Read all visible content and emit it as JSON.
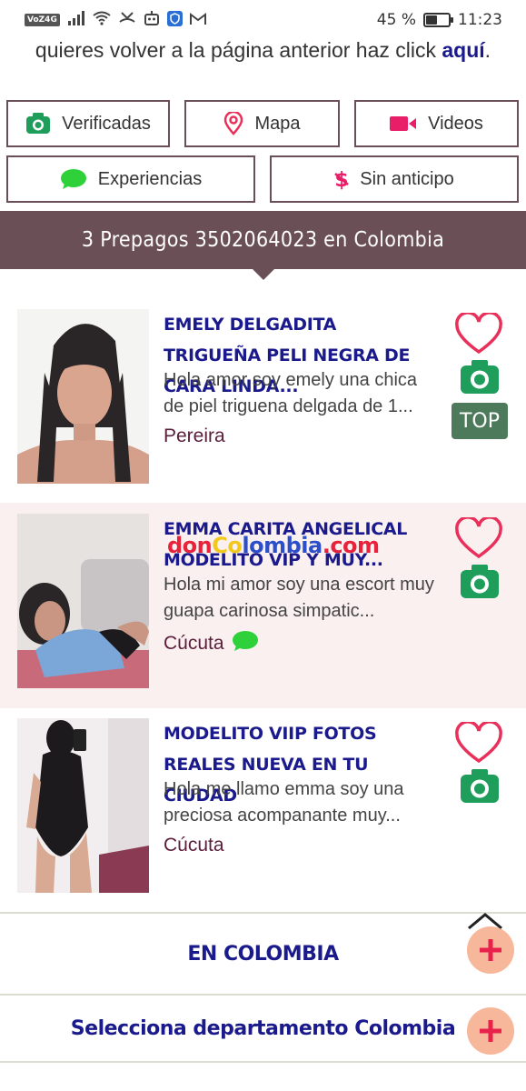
{
  "status_bar": {
    "carrier_badge": "VoZ4G",
    "battery_text": "45 %",
    "battery_level": 0.45,
    "time": "11:23",
    "icons": [
      "signal-icon",
      "wifi-icon",
      "missed-call-icon",
      "bot-icon",
      "shield-icon",
      "gmail-icon"
    ]
  },
  "back_line": {
    "text": "quieres volver a la página anterior haz click ",
    "link": "aquí",
    "suffix": "."
  },
  "filters": {
    "verificadas": "Verificadas",
    "mapa": "Mapa",
    "videos": "Videos",
    "experiencias": "Experiencias",
    "sin_anticipo": "Sin anticipo"
  },
  "banner_title": "3 Prepagos 3502064023 en Colombia",
  "listings": [
    {
      "title": "EMELY DELGADITA TRIGUEÑA PELI NEGRA DE CARA LINDA...",
      "description": "Hola amor soy emely una chica de piel triguena delgada de 1...",
      "city": "Pereira",
      "badge": "TOP"
    },
    {
      "title": "EMMA CARITA ANGELICAL MODELITO VIP Y MUY...",
      "description": "Hola mi amor soy una escort muy guapa carinosa simpatic...",
      "city": "Cúcuta"
    },
    {
      "title": "MODELITO VIIP FOTOS REALES NUEVA EN TU CIUDAD",
      "description": "Hola me llamo emma soy una preciosa acompanante muy...",
      "city": "Cúcuta"
    }
  ],
  "watermark": {
    "p1": "don",
    "p2": "Co",
    "p3": "lombia",
    "p4": ".com"
  },
  "accordions": {
    "colombia": "EN COLOMBIA",
    "departamento": "Selecciona departamento Colombia"
  },
  "colors": {
    "accent": "#6b4f57",
    "title_blue": "#1a1a8c",
    "icon_green": "#1e9e5a",
    "heart_pink": "#e8305a",
    "plus_bg": "#f7b79a"
  }
}
